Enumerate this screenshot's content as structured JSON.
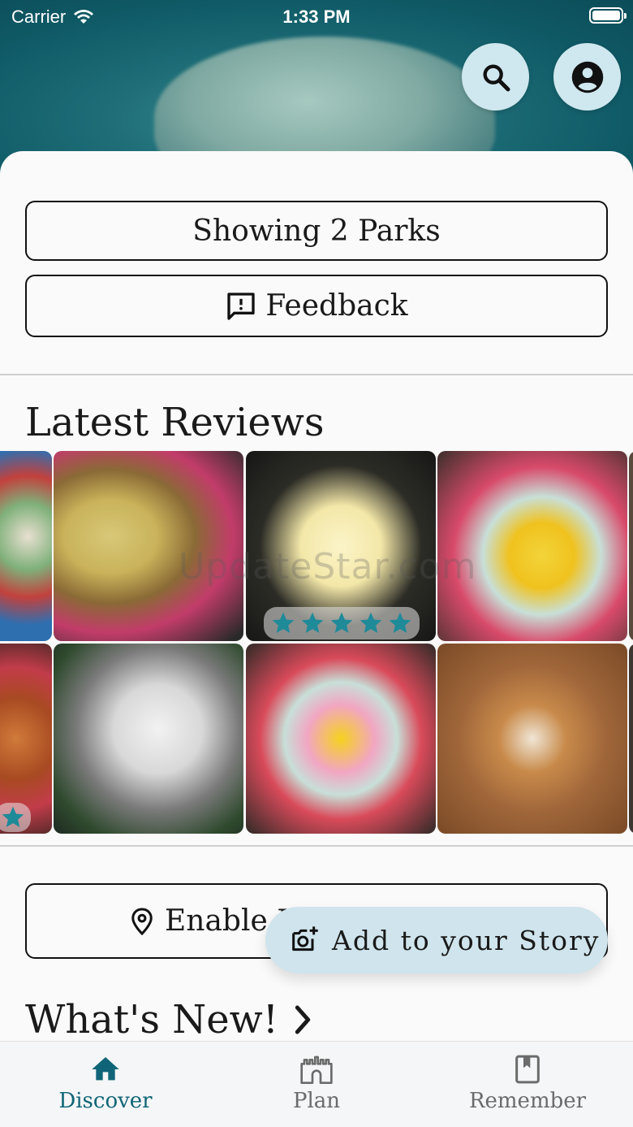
{
  "status_bar": {
    "carrier": "Carrier",
    "time": "1:33 PM"
  },
  "header": {
    "search_icon": "search-icon",
    "account_icon": "account-circle-icon"
  },
  "parks_button": {
    "label": "Showing 2 Parks"
  },
  "feedback_button": {
    "label": "Feedback",
    "icon": "feedback-icon"
  },
  "latest_reviews": {
    "title": "Latest Reviews",
    "watermark": "UpdateStar.com",
    "tiles": [
      {
        "subject": "colorful tacos plate",
        "rating": null
      },
      {
        "subject": "tacos on paper plate",
        "rating": null
      },
      {
        "subject": "soft serve cone",
        "rating": 5
      },
      {
        "subject": "float in cup",
        "rating": null
      },
      {
        "subject": "nachos with cheese",
        "rating": 1
      },
      {
        "subject": "AT-AT ornaments",
        "rating": null
      },
      {
        "subject": "pink swirl float",
        "rating": null
      },
      {
        "subject": "churro with toppings",
        "rating": null
      }
    ]
  },
  "location_button": {
    "label": "Enable L",
    "icon": "location-pin-icon"
  },
  "whats_new": {
    "title": "What's New!"
  },
  "fab": {
    "label": "Add to your Story",
    "icon": "add-photo-icon"
  },
  "bottom_nav": {
    "items": [
      {
        "label": "Discover",
        "icon": "home-icon",
        "active": true
      },
      {
        "label": "Plan",
        "icon": "castle-icon",
        "active": false
      },
      {
        "label": "Remember",
        "icon": "book-icon",
        "active": false
      }
    ]
  },
  "colors": {
    "accent": "#0f6577",
    "fab_bg": "#cfe4ec",
    "header_teal": "#1f6e78",
    "star_teal": "#1f8a98"
  }
}
